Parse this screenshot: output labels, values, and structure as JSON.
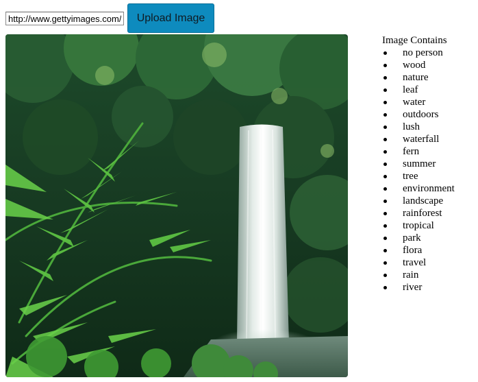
{
  "upload_form": {
    "url_value": "http://www.gettyimages.com/",
    "button_label": "Upload Image"
  },
  "tags": {
    "title": "Image Contains",
    "items": [
      "no person",
      "wood",
      "nature",
      "leaf",
      "water",
      "outdoors",
      "lush",
      "waterfall",
      "fern",
      "summer",
      "tree",
      "environment",
      "landscape",
      "rainforest",
      "tropical",
      "park",
      "flora",
      "travel",
      "rain",
      "river"
    ]
  }
}
